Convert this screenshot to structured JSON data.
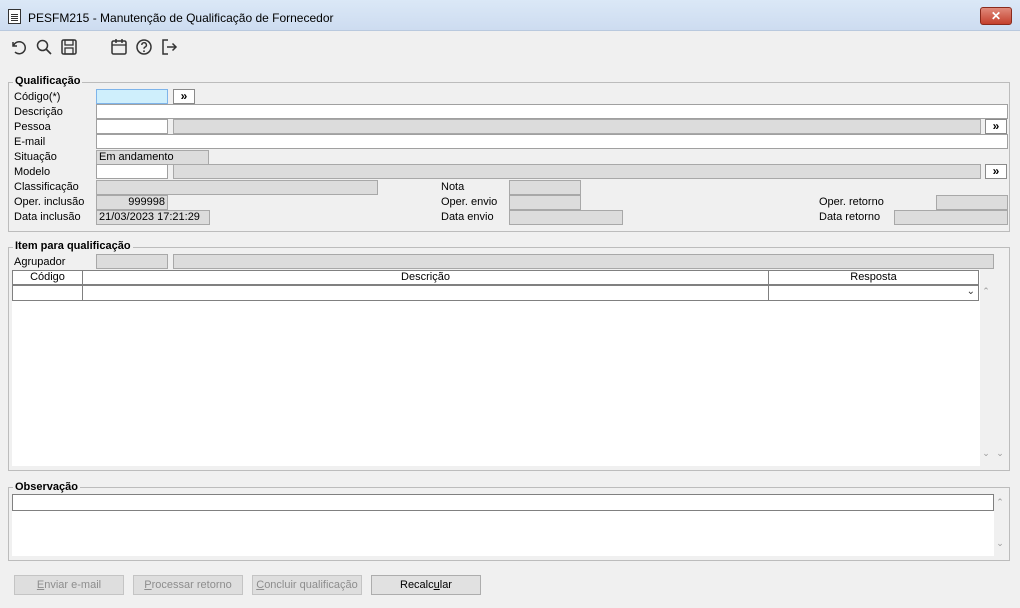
{
  "window": {
    "title": "PESFM215 - Manutenção de Qualificação de Fornecedor",
    "close_label": "✕"
  },
  "toolbar": {
    "icons": [
      "undo-icon",
      "search-icon",
      "save-icon",
      "calendar-icon",
      "help-icon",
      "exit-icon"
    ]
  },
  "qualificacao": {
    "legend": "Qualificação",
    "codigo_label": "Código(*)",
    "codigo_value": "",
    "descricao_label": "Descrição",
    "descricao_value": "",
    "pessoa_label": "Pessoa",
    "pessoa_code": "",
    "pessoa_name": "",
    "email_label": "E-mail",
    "email_value": "",
    "situacao_label": "Situação",
    "situacao_value": "Em andamento",
    "modelo_label": "Modelo",
    "modelo_code": "",
    "modelo_name": "",
    "classificacao_label": "Classificação",
    "classificacao_value": "",
    "nota_label": "Nota",
    "nota_value": "",
    "oper_inclusao_label": "Oper. inclusão",
    "oper_inclusao_value": "999998",
    "oper_envio_label": "Oper. envio",
    "oper_envio_value": "",
    "oper_retorno_label": "Oper. retorno",
    "oper_retorno_value": "",
    "data_inclusao_label": "Data inclusão",
    "data_inclusao_value": "21/03/2023 17:21:29",
    "data_envio_label": "Data envio",
    "data_envio_value": "",
    "data_retorno_label": "Data retorno",
    "data_retorno_value": "",
    "lookup_label": "»"
  },
  "itens": {
    "legend": "Item para qualificação",
    "agrupador_label": "Agrupador",
    "agrupador_code": "",
    "agrupador_name": "",
    "columns": [
      "Código",
      "Descrição",
      "Resposta"
    ],
    "rows": [
      {
        "codigo": "",
        "descricao": "",
        "resposta": ""
      }
    ]
  },
  "observacao": {
    "legend": "Observação",
    "value": ""
  },
  "buttons": {
    "enviar_email_pre": "",
    "enviar_email_u": "E",
    "enviar_email_post": "nviar e-mail",
    "processar_retorno_pre": "",
    "processar_retorno_u": "P",
    "processar_retorno_post": "rocessar retorno",
    "concluir_pre": "",
    "concluir_u": "C",
    "concluir_post": "oncluir qualificação",
    "recalcular_pre": "Recalc",
    "recalcular_u": "u",
    "recalcular_post": "lar"
  }
}
